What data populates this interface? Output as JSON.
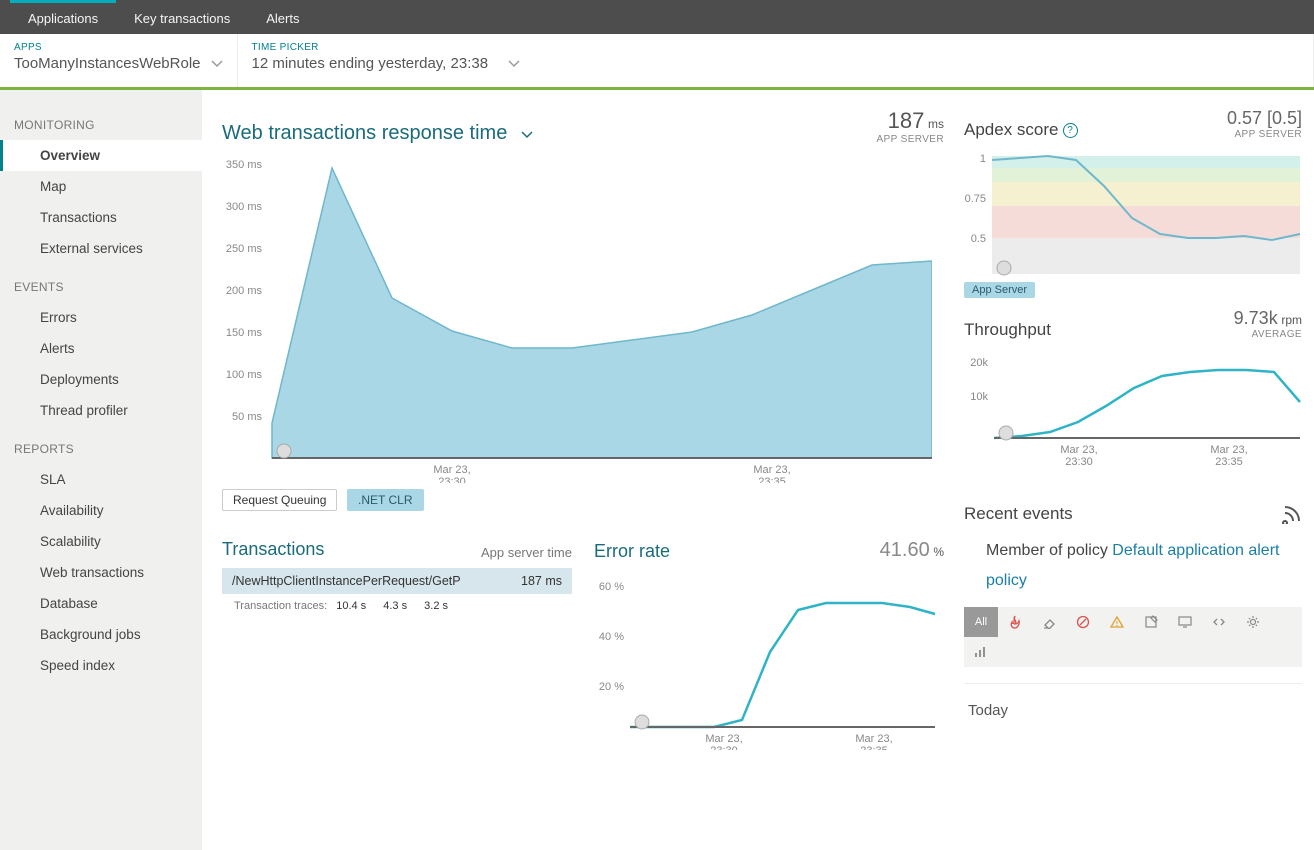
{
  "topnav": {
    "items": [
      "Applications",
      "Key transactions",
      "Alerts"
    ],
    "active": 0
  },
  "subbar": {
    "apps_label": "APPS",
    "app_name": "TooManyInstancesWebRole",
    "time_label": "TIME PICKER",
    "time_value": "12 minutes ending yesterday, 23:38"
  },
  "sidebar": {
    "monitoring_label": "MONITORING",
    "monitoring": [
      "Overview",
      "Map",
      "Transactions",
      "External services"
    ],
    "monitoring_active": 0,
    "events_label": "EVENTS",
    "events": [
      "Errors",
      "Alerts",
      "Deployments",
      "Thread profiler"
    ],
    "reports_label": "REPORTS",
    "reports": [
      "SLA",
      "Availability",
      "Scalability",
      "Web transactions",
      "Database",
      "Background jobs",
      "Speed index"
    ]
  },
  "response_time": {
    "title": "Web transactions response time",
    "value": "187",
    "unit": "ms",
    "sub": "APP SERVER",
    "legend": {
      "queuing": "Request Queuing",
      "netclr": ".NET CLR"
    }
  },
  "apdex": {
    "title": "Apdex score",
    "value": "0.57 [0.5]",
    "sub": "APP SERVER",
    "badge": "App Server"
  },
  "throughput": {
    "title": "Throughput",
    "value": "9.73k",
    "unit": "rpm",
    "sub": "AVERAGE"
  },
  "transactions": {
    "title": "Transactions",
    "subtitle": "App server time",
    "row_name": "/NewHttpClientInstancePerRequest/GetP",
    "row_time": "187 ms",
    "traces_label": "Transaction traces:",
    "traces": [
      "10.4 s",
      "4.3 s",
      "3.2 s"
    ]
  },
  "error_rate": {
    "title": "Error rate",
    "value": "41.60",
    "unit": "%"
  },
  "events_panel": {
    "title": "Recent events",
    "policy_prefix": "Member of policy ",
    "policy_link": "Default application alert policy",
    "filter_all": "All",
    "today": "Today"
  },
  "xlabels": {
    "a": "Mar 23,",
    "a2": "23:30",
    "b": "Mar 23,",
    "b2": "23:35"
  },
  "chart_data": [
    {
      "id": "response_time",
      "type": "area",
      "title": "Web transactions response time",
      "ylabel": "ms",
      "ylim": [
        0,
        350
      ],
      "yticks": [
        50,
        100,
        150,
        200,
        250,
        300,
        350
      ],
      "x": [
        "23:27",
        "23:28",
        "23:29",
        "23:30",
        "23:31",
        "23:32",
        "23:33",
        "23:34",
        "23:35",
        "23:36",
        "23:37",
        "23:38"
      ],
      "series": [
        {
          "name": ".NET CLR",
          "values": [
            50,
            340,
            200,
            160,
            140,
            140,
            150,
            160,
            180,
            210,
            240,
            245
          ]
        },
        {
          "name": "Request Queuing",
          "values": [
            0,
            0,
            0,
            0,
            0,
            0,
            0,
            0,
            0,
            0,
            0,
            0
          ]
        }
      ],
      "xticks": [
        {
          "pos": 3,
          "label": "Mar 23, 23:30"
        },
        {
          "pos": 8,
          "label": "Mar 23, 23:35"
        }
      ]
    },
    {
      "id": "apdex",
      "type": "line",
      "title": "Apdex score",
      "ylim": [
        0,
        1
      ],
      "yticks": [
        0.5,
        0.75,
        1
      ],
      "bands": [
        {
          "from": 0.94,
          "to": 1.0,
          "color": "excellent"
        },
        {
          "from": 0.85,
          "to": 0.94,
          "color": "good"
        },
        {
          "from": 0.7,
          "to": 0.85,
          "color": "fair"
        },
        {
          "from": 0.5,
          "to": 0.7,
          "color": "poor"
        }
      ],
      "x": [
        "23:27",
        "23:28",
        "23:29",
        "23:30",
        "23:31",
        "23:32",
        "23:33",
        "23:34",
        "23:35",
        "23:36",
        "23:37",
        "23:38"
      ],
      "series": [
        {
          "name": "App Server",
          "values": [
            0.98,
            0.99,
            1.0,
            0.98,
            0.82,
            0.62,
            0.52,
            0.5,
            0.5,
            0.51,
            0.49,
            0.52
          ]
        }
      ],
      "xticks": [
        {
          "pos": 3,
          "label": "Mar 23, 23:30"
        },
        {
          "pos": 8,
          "label": "Mar 23, 23:35"
        }
      ]
    },
    {
      "id": "throughput",
      "type": "line",
      "title": "Throughput",
      "ylabel": "rpm",
      "ylim": [
        0,
        20000
      ],
      "yticks": [
        10000,
        20000
      ],
      "ytick_labels": [
        "10k",
        "20k"
      ],
      "x": [
        "23:27",
        "23:28",
        "23:29",
        "23:30",
        "23:31",
        "23:32",
        "23:33",
        "23:34",
        "23:35",
        "23:36",
        "23:37",
        "23:38"
      ],
      "series": [
        {
          "name": "Throughput",
          "values": [
            0,
            500,
            1500,
            4000,
            8000,
            12000,
            15000,
            16000,
            16500,
            16500,
            16000,
            9000
          ]
        }
      ],
      "xticks": [
        {
          "pos": 3,
          "label": "Mar 23, 23:30"
        },
        {
          "pos": 8,
          "label": "Mar 23, 23:35"
        }
      ]
    },
    {
      "id": "error_rate",
      "type": "line",
      "title": "Error rate",
      "ylabel": "%",
      "ylim": [
        0,
        60
      ],
      "yticks": [
        20,
        40,
        60
      ],
      "x": [
        "23:27",
        "23:28",
        "23:29",
        "23:30",
        "23:31",
        "23:32",
        "23:33",
        "23:34",
        "23:35",
        "23:36",
        "23:37",
        "23:38"
      ],
      "series": [
        {
          "name": "Error rate",
          "values": [
            0,
            0,
            0,
            0,
            3,
            30,
            47,
            50,
            50,
            50,
            48,
            45
          ]
        }
      ],
      "xticks": [
        {
          "pos": 3,
          "label": "Mar 23, 23:30"
        },
        {
          "pos": 8,
          "label": "Mar 23, 23:35"
        }
      ]
    }
  ]
}
